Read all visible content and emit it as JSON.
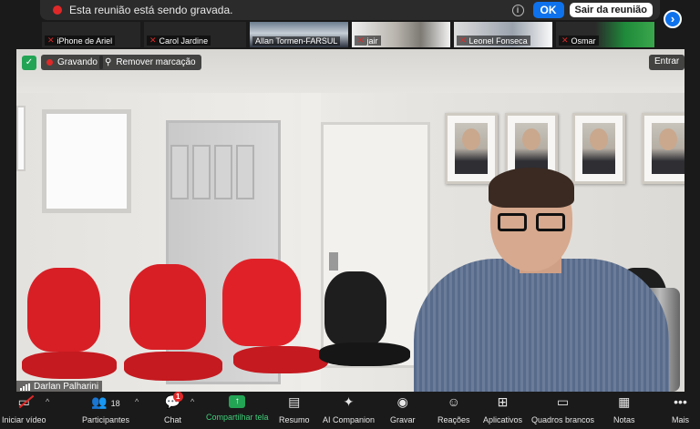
{
  "recording_banner": {
    "text": "Esta reunião está sendo gravada.",
    "ok_label": "OK",
    "leave_label": "Sair da reunião"
  },
  "thumbnails": [
    {
      "name": "iPhone de Ariel",
      "muted": true
    },
    {
      "name": "Carol Jardine",
      "muted": true
    },
    {
      "name": "Allan Tormen-FARSUL",
      "muted": false
    },
    {
      "name": "jair",
      "muted": true
    },
    {
      "name": "Leonel Fonseca",
      "muted": true
    },
    {
      "name": "Osmar",
      "muted": true
    }
  ],
  "main": {
    "recording_label": "Gravando",
    "remove_mark_label": "Remover marcação",
    "enter_label": "Entrar",
    "speaker_name": "Darlan Palharini"
  },
  "toolbar": {
    "start_video": "Iniciar vídeo",
    "participants": "Participantes",
    "participants_count": "18",
    "chat": "Chat",
    "chat_badge": "1",
    "share_screen": "Compartilhar tela",
    "summary": "Resumo",
    "ai_companion": "AI Companion",
    "record": "Gravar",
    "reactions": "Reações",
    "apps": "Aplicativos",
    "whiteboards": "Quadros brancos",
    "notes": "Notas",
    "more": "Mais"
  },
  "colors": {
    "accent_blue": "#0e72ed",
    "recording_red": "#e02828",
    "share_green": "#23a455"
  },
  "icons": {
    "info": "info-icon",
    "mic_off": "mic-off-icon",
    "shield": "shield-icon",
    "pin": "pin-icon",
    "video_off": "video-off-icon",
    "participants": "participants-icon",
    "chat": "chat-icon",
    "share": "share-screen-icon"
  }
}
